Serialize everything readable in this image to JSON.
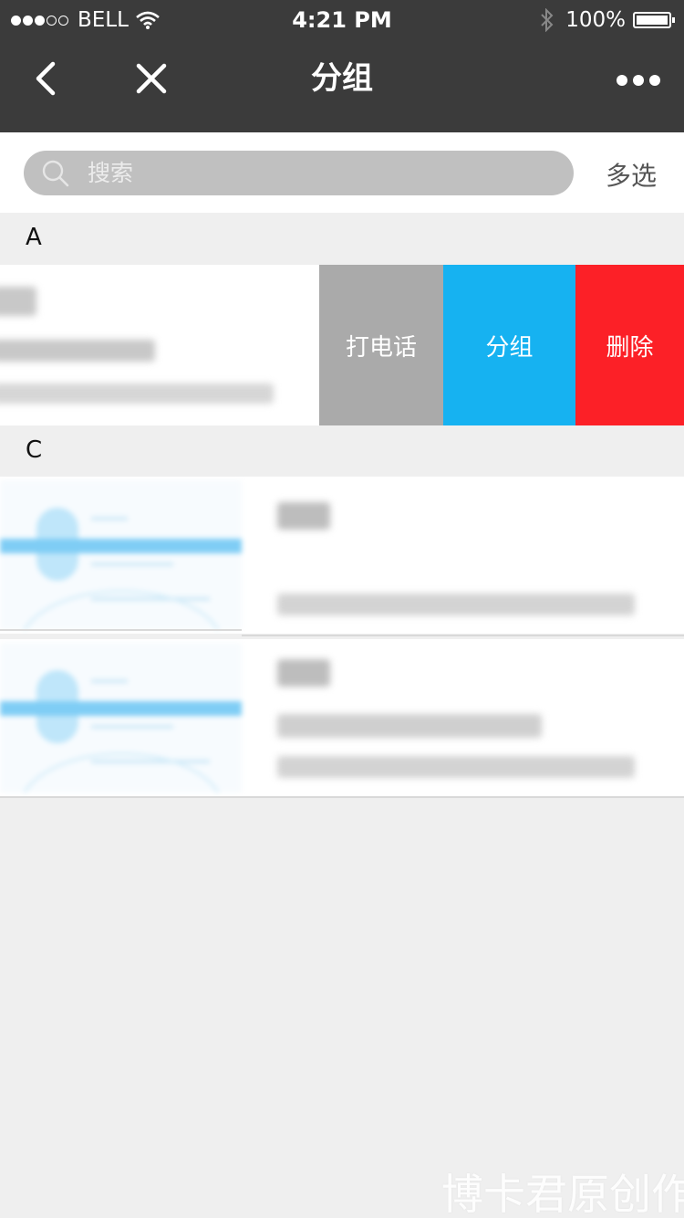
{
  "status_bar": {
    "carrier": "BELL",
    "time": "4:21 PM",
    "battery": "100%"
  },
  "nav": {
    "title": "分组"
  },
  "search": {
    "placeholder": "搜索",
    "multi_select_label": "多选"
  },
  "sections": [
    {
      "letter": "A"
    },
    {
      "letter": "C"
    }
  ],
  "swipe_actions": {
    "call_label": "打电话",
    "group_label": "分组",
    "delete_label": "删除"
  },
  "watermark": "博卡君原创作",
  "colors": {
    "nav_bg": "#3b3b3b",
    "call": "#aaaaaa",
    "group": "#16b2f1",
    "delete": "#fc2027"
  }
}
